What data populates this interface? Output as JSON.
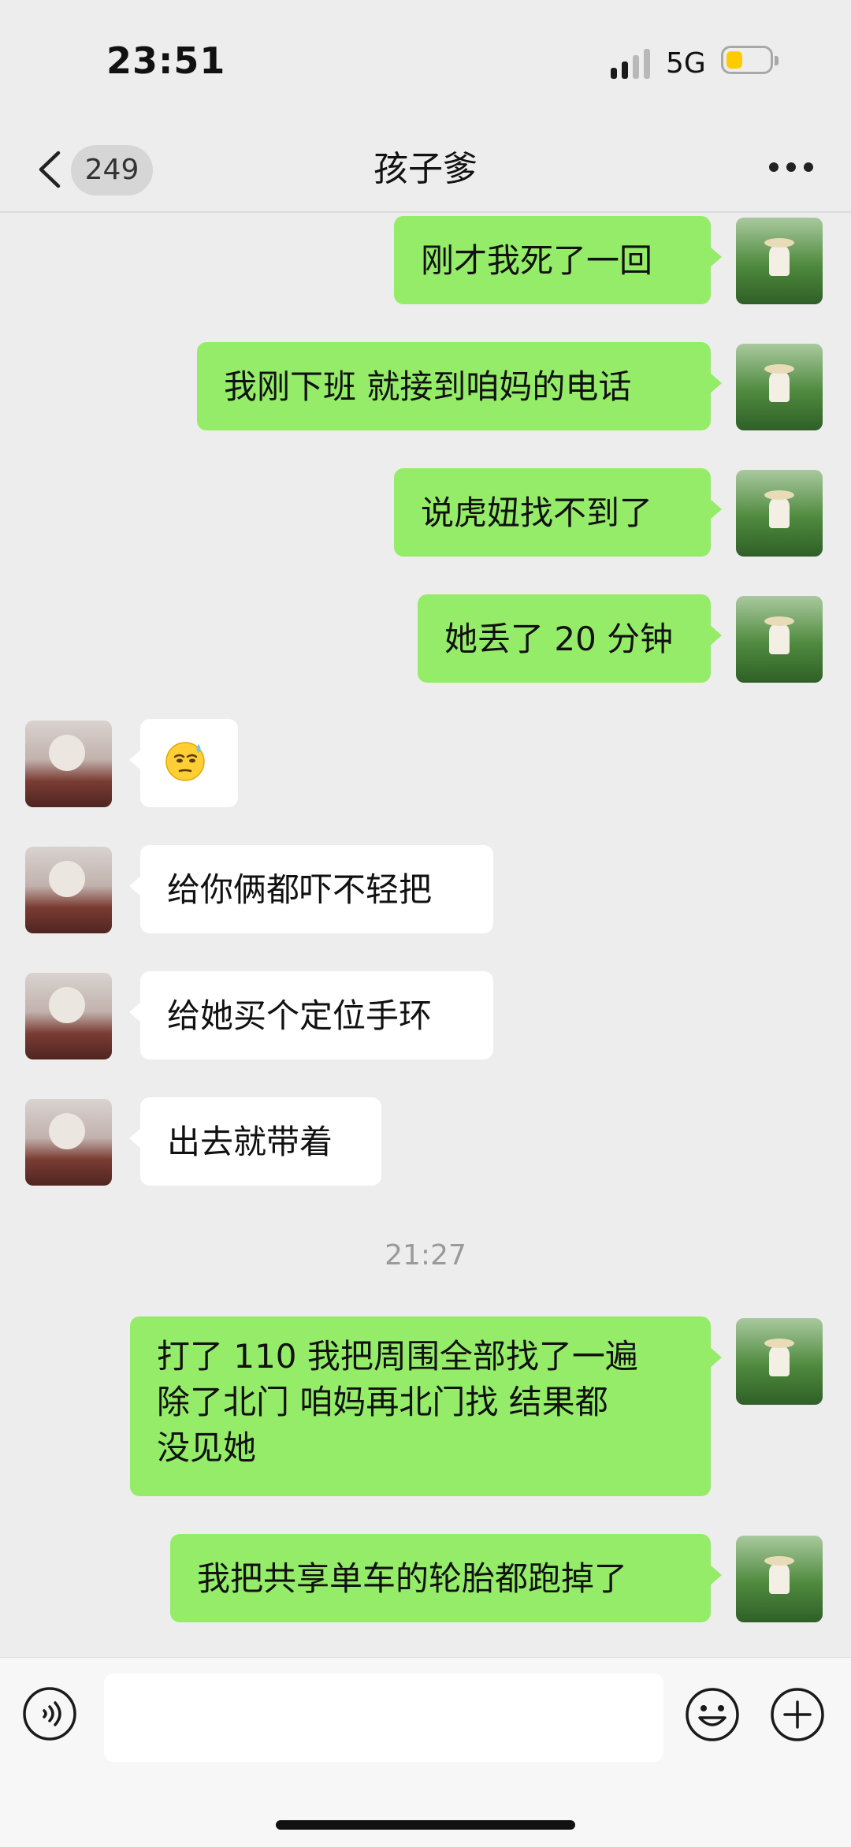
{
  "status_bar": {
    "time": "23:51",
    "network": "5G"
  },
  "header": {
    "back_count": "249",
    "title": "孩子爹"
  },
  "messages": [
    {
      "from": "self",
      "text": "刚才我死了一回"
    },
    {
      "from": "self",
      "text": "我刚下班 就接到咱妈的电话"
    },
    {
      "from": "self",
      "text": "说虎妞找不到了"
    },
    {
      "from": "self",
      "text": "她丢了 20 分钟"
    },
    {
      "from": "other",
      "emoji": "sweat-smile-emoji"
    },
    {
      "from": "other",
      "text": "给你俩都吓不轻把"
    },
    {
      "from": "other",
      "text": "给她买个定位手环"
    },
    {
      "from": "other",
      "text": "出去就带着"
    },
    {
      "from": "self",
      "text": "打了 110 我把周围全部找了一遍\n除了北门 咱妈再北门找 结果都\n没见她"
    },
    {
      "from": "self",
      "text": "我把共享单车的轮胎都跑掉了"
    }
  ],
  "timestamp": "21:27",
  "input": {
    "placeholder": ""
  },
  "colors": {
    "self_bubble": "#95ec69",
    "other_bubble": "#ffffff",
    "background": "#ededed"
  },
  "icons": {
    "back": "chevron-left-icon",
    "more": "more-dots-icon",
    "voice": "voice-icon",
    "emoji": "emoji-icon",
    "plus": "plus-icon"
  }
}
